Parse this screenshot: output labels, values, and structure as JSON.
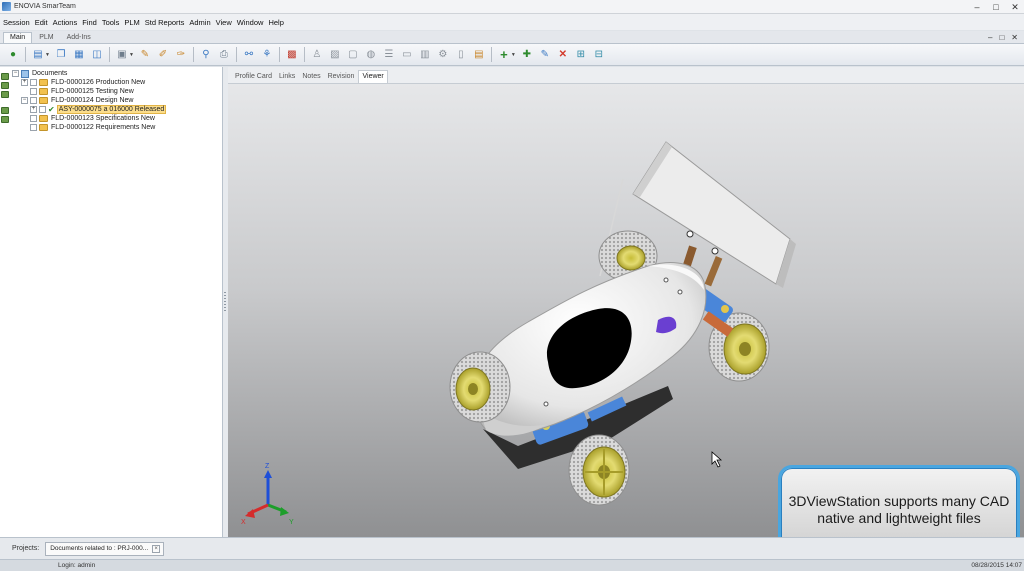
{
  "window": {
    "title": "ENOVIA SmarTeam",
    "controls": [
      "–",
      "□",
      "✕"
    ],
    "mdi_controls": [
      "–",
      "□",
      "✕"
    ]
  },
  "menu": [
    "Session",
    "Edit",
    "Actions",
    "Find",
    "Tools",
    "PLM",
    "Std Reports",
    "Admin",
    "View",
    "Window",
    "Help"
  ],
  "ribbon_tabs": [
    {
      "label": "Main",
      "active": true
    },
    {
      "label": "PLM",
      "active": false
    },
    {
      "label": "Add-Ins",
      "active": false
    }
  ],
  "tree": {
    "root": "Documents",
    "items": [
      {
        "label": "FLD-0000126  Production New"
      },
      {
        "label": "FLD-0000125  Testing New"
      },
      {
        "label": "FLD-0000124  Design New"
      },
      {
        "label": "ASY-0000075 a 016000 Released"
      },
      {
        "label": "FLD-0000123  Specifications New"
      },
      {
        "label": "FLD-0000122  Requirements New"
      }
    ]
  },
  "view_tabs": [
    {
      "label": "Profile Card",
      "active": false
    },
    {
      "label": "Links",
      "active": false
    },
    {
      "label": "Notes",
      "active": false
    },
    {
      "label": "Revision",
      "active": false
    },
    {
      "label": "Viewer",
      "active": true
    }
  ],
  "viewer": {
    "axis_labels": {
      "z": "Z",
      "x": "X",
      "y": "Y"
    },
    "caption": "3DViewStation supports many CAD native and lightweight files"
  },
  "projects_bar": {
    "label": "Projects:",
    "tab": "Documents related to : PRJ-000..."
  },
  "status": {
    "login": "Login: admin",
    "datetime": "08/28/2015 14:07"
  },
  "colors": {
    "accent": "#49a6e0",
    "car_body": "#f1f1f1",
    "wheel_rim": "#d8cf5a",
    "suspension": "#4a86d9",
    "selection": "#fbdd8c"
  }
}
